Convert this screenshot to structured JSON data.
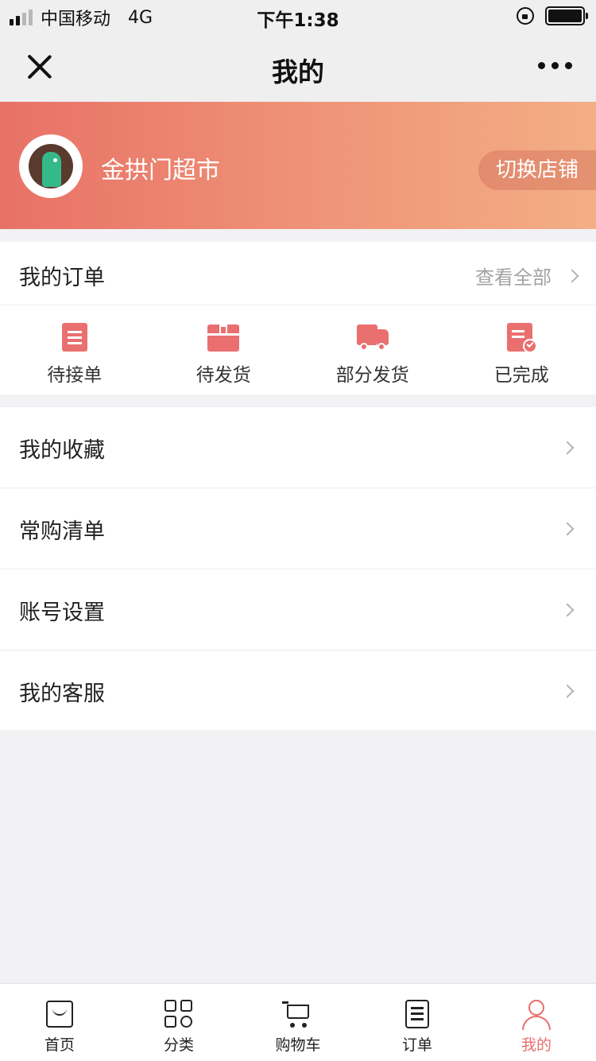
{
  "status_bar": {
    "carrier": "中国移动",
    "network": "4G",
    "time": "下午1:38"
  },
  "nav": {
    "title": "我的"
  },
  "profile": {
    "store_name": "金拱门超市",
    "switch_store_label": "切换店铺"
  },
  "orders": {
    "title": "我的订单",
    "view_all_label": "查看全部",
    "statuses": [
      {
        "label": "待接单",
        "icon": "list-icon"
      },
      {
        "label": "待发货",
        "icon": "package-icon"
      },
      {
        "label": "部分发货",
        "icon": "truck-icon"
      },
      {
        "label": "已完成",
        "icon": "completed-doc-icon"
      }
    ]
  },
  "menu": {
    "items": [
      {
        "label": "我的收藏"
      },
      {
        "label": "常购清单"
      },
      {
        "label": "账号设置"
      },
      {
        "label": "我的客服"
      }
    ]
  },
  "tab_bar": {
    "items": [
      {
        "label": "首页",
        "icon": "home-icon"
      },
      {
        "label": "分类",
        "icon": "category-icon"
      },
      {
        "label": "购物车",
        "icon": "cart-icon"
      },
      {
        "label": "订单",
        "icon": "order-icon"
      },
      {
        "label": "我的",
        "icon": "profile-icon"
      }
    ],
    "active_color": "#e86f6f"
  },
  "colors": {
    "accent": "#ea6f6f",
    "banner_start": "#e87166",
    "banner_end": "#f3ae84"
  }
}
